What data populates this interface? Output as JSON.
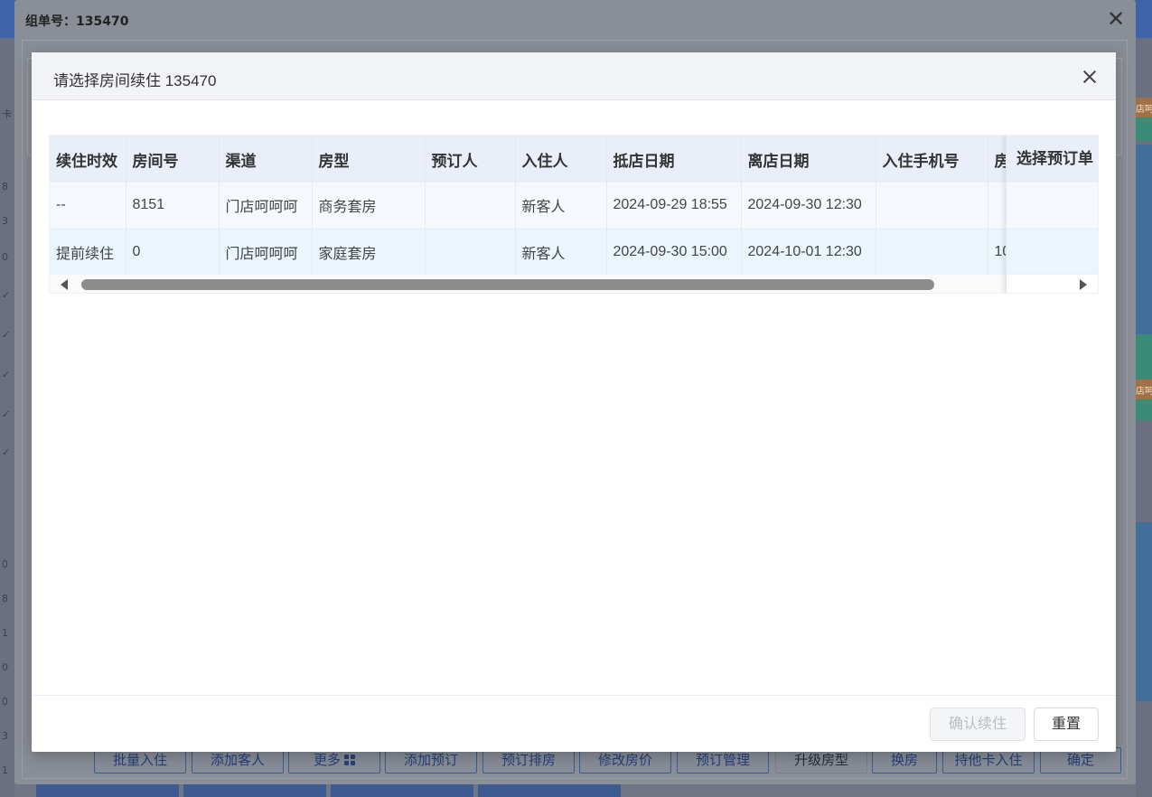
{
  "outer_dialog": {
    "title": "组单号：135470",
    "close_glyph": "✕"
  },
  "modal": {
    "title": "请选择房间续住 135470",
    "table": {
      "columns": [
        "续住时效",
        "房间号",
        "渠道",
        "房型",
        "预订人",
        "入住人",
        "抵店日期",
        "离店日期",
        "入住手机号",
        "房"
      ],
      "rows": [
        [
          "--",
          "8151",
          "门店呵呵呵",
          "商务套房",
          "",
          "新客人",
          "2024-09-29 18:55",
          "2024-09-30 12:30",
          "",
          ""
        ],
        [
          "提前续住",
          "0",
          "门店呵呵呵",
          "家庭套房",
          "",
          "新客人",
          "2024-09-30 15:00",
          "2024-10-01 12:30",
          "",
          "10"
        ]
      ],
      "fixed_column": "选择预订单"
    },
    "footer": {
      "confirm_label": "确认续住",
      "reset_label": "重置"
    }
  },
  "bottom_bar": {
    "buttons": [
      "批量入住",
      "添加客人",
      "更多",
      "添加预订",
      "预订排房",
      "修改房价",
      "预订管理",
      "升级房型",
      "换房",
      "持他卡入住",
      "确定"
    ]
  },
  "left_strip_values": [
    "卡",
    "8",
    "3",
    "0",
    "✓",
    "✓",
    "✓",
    "✓",
    "✓",
    "0",
    "8",
    "1",
    "0",
    "0",
    "3",
    "1"
  ],
  "right_tags": [
    "店呵",
    "店呵"
  ]
}
